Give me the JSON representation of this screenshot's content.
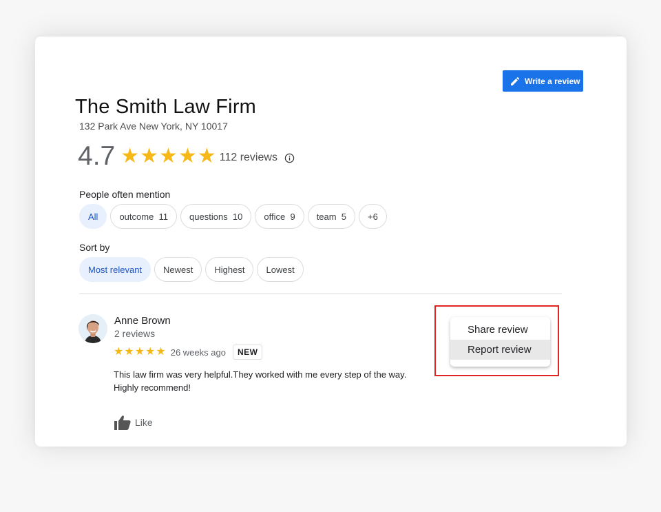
{
  "business": {
    "name": "The Smith Law Firm",
    "address": "132 Park Ave New York, NY 10017",
    "rating": "4.7",
    "rating_stars": 5,
    "review_count": "112 reviews"
  },
  "actions": {
    "write_review_label": "Write a review"
  },
  "mentions": {
    "label": "People often mention",
    "chips": [
      {
        "label": "All",
        "active": true
      },
      {
        "label": "outcome  11",
        "active": false
      },
      {
        "label": "questions  10",
        "active": false
      },
      {
        "label": "office  9",
        "active": false
      },
      {
        "label": "team  5",
        "active": false
      },
      {
        "label": "+6",
        "active": false
      }
    ]
  },
  "sort": {
    "label": "Sort by",
    "options": [
      {
        "label": "Most relevant",
        "active": true
      },
      {
        "label": "Newest",
        "active": false
      },
      {
        "label": "Highest",
        "active": false
      },
      {
        "label": "Lowest",
        "active": false
      }
    ]
  },
  "review": {
    "author": "Anne Brown",
    "author_reviews": "2 reviews",
    "stars": 5,
    "time": "26 weeks ago",
    "badge": "NEW",
    "text": "This law firm was very helpful.They worked with me every step of the way. Highly recommend!",
    "like_label": "Like"
  },
  "context_menu": {
    "items": [
      {
        "label": "Share review",
        "hovered": false
      },
      {
        "label": "Report review",
        "hovered": true
      }
    ]
  },
  "colors": {
    "accent": "#1a73e8",
    "star": "#f6b818",
    "highlight": "#e02424"
  }
}
